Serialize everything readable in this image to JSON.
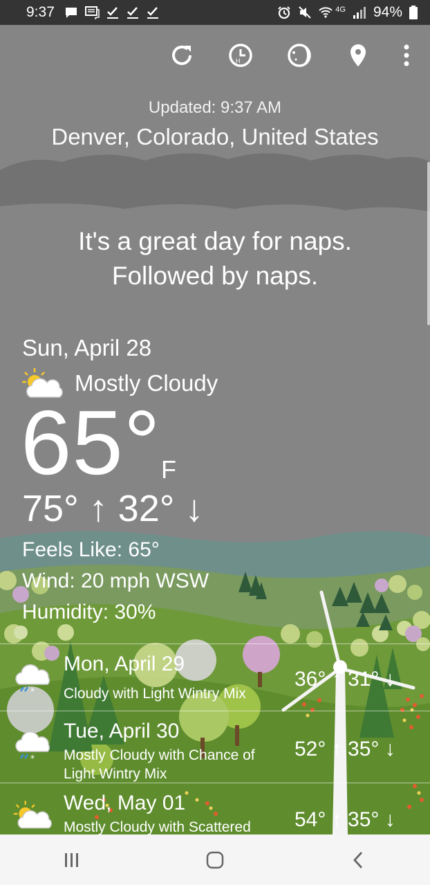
{
  "status_bar": {
    "time": "9:37",
    "network": "4G",
    "battery": "94%",
    "notification_icons": [
      "message-icon",
      "chat-icon",
      "check-icon",
      "check-icon",
      "check-icon"
    ],
    "system_icons": [
      "alarm-icon",
      "mute-icon",
      "wifi-icon",
      "signal-icon",
      "battery-icon"
    ]
  },
  "toolbar": {
    "icons": [
      "refresh-icon",
      "history-icon",
      "moon-phase-icon",
      "location-pin-icon",
      "more-vert-icon"
    ]
  },
  "header": {
    "updated": "Updated: 9:37 AM",
    "location": "Denver, Colorado, United States"
  },
  "tagline": {
    "line1": "It's a great day for naps.",
    "line2": "Followed by naps."
  },
  "current": {
    "date": "Sun, April 28",
    "condition": "Mostly Cloudy",
    "condition_icon": "partly-cloudy-icon",
    "temperature": "65°",
    "unit": "F",
    "high_low": "75° ↑ 32° ↓",
    "feels_like": "Feels Like: 65°",
    "wind": "Wind: 20 mph WSW",
    "humidity": "Humidity: 30%"
  },
  "forecast": [
    {
      "day": "Mon, April 29",
      "desc": "Cloudy with Light Wintry Mix",
      "temps": "36° ↑ 31° ↓",
      "icon": "wintry-mix-icon"
    },
    {
      "day": "Tue, April 30",
      "desc": "Mostly Cloudy with Chance of Light Wintry Mix",
      "temps": "52° ↑ 35° ↓",
      "icon": "wintry-mix-icon"
    },
    {
      "day": "Wed, May 01",
      "desc": "Mostly Cloudy with Scattered",
      "temps": "54° ↑ 35° ↓",
      "icon": "partly-cloudy-icon"
    }
  ],
  "nav": {
    "icons": [
      "recent-apps-icon",
      "home-icon",
      "back-icon"
    ]
  },
  "colors": {
    "sky": "#858585",
    "status_bar": "#343434",
    "hills": "#6f9a3a",
    "nav_bar": "#f5f5f5"
  }
}
